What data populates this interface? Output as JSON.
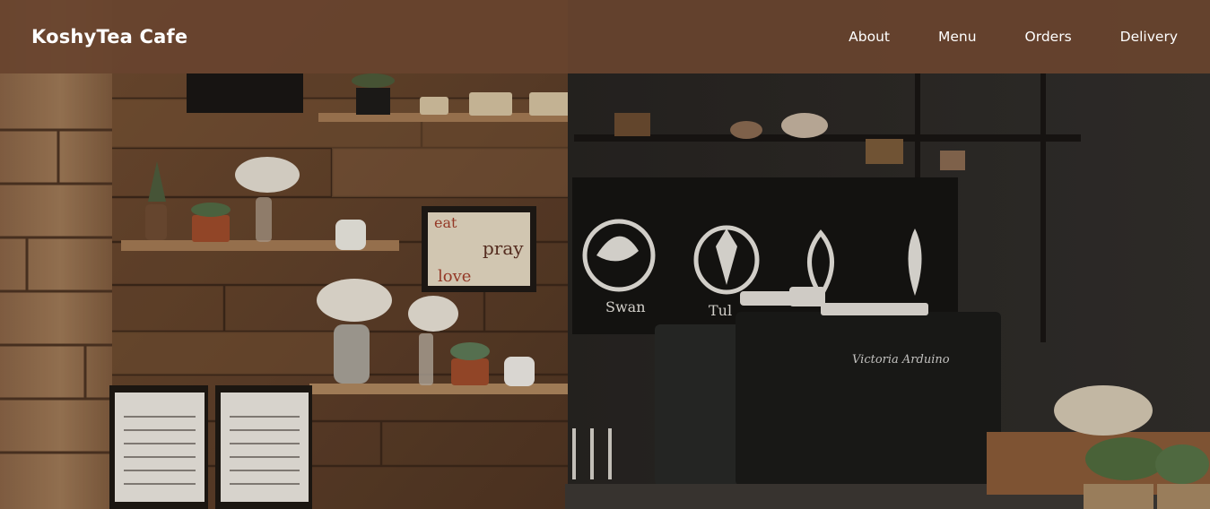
{
  "brand": {
    "name": "KoshyTea Cafe"
  },
  "nav": {
    "items": [
      "About",
      "Menu",
      "Orders",
      "Delivery"
    ]
  },
  "hero": {
    "board_words": [
      "eat",
      "pray",
      "love"
    ],
    "wall_art_labels": [
      "Swan",
      "Tul"
    ],
    "machine_brand": "Victoria Arduino"
  },
  "colors": {
    "navbar": "#68442e",
    "wood": "#6b4a32",
    "dark_wall": "#1f1c1b",
    "text": "#ffffff"
  }
}
